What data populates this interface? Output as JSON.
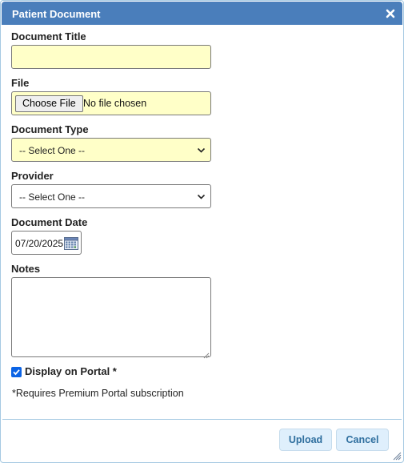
{
  "dialog": {
    "title": "Patient Document",
    "close_icon": "close-icon"
  },
  "form": {
    "title_label": "Document Title",
    "title_value": "",
    "file_label": "File",
    "file_button": "Choose File",
    "file_status": "No file chosen",
    "type_label": "Document Type",
    "type_selected": "-- Select One --",
    "provider_label": "Provider",
    "provider_selected": "-- Select One --",
    "date_label": "Document Date",
    "date_value": "07/20/2025",
    "notes_label": "Notes",
    "notes_value": "",
    "portal_label": "Display on Portal *",
    "portal_checked": true,
    "footnote": "*Requires Premium Portal subscription"
  },
  "buttons": {
    "upload": "Upload",
    "cancel": "Cancel"
  },
  "colors": {
    "titlebar": "#4a7ebb",
    "required_field": "#ffffc8",
    "button_bg": "#dfeffc",
    "button_text": "#2e6e9e",
    "checkbox": "#0b63e5"
  }
}
